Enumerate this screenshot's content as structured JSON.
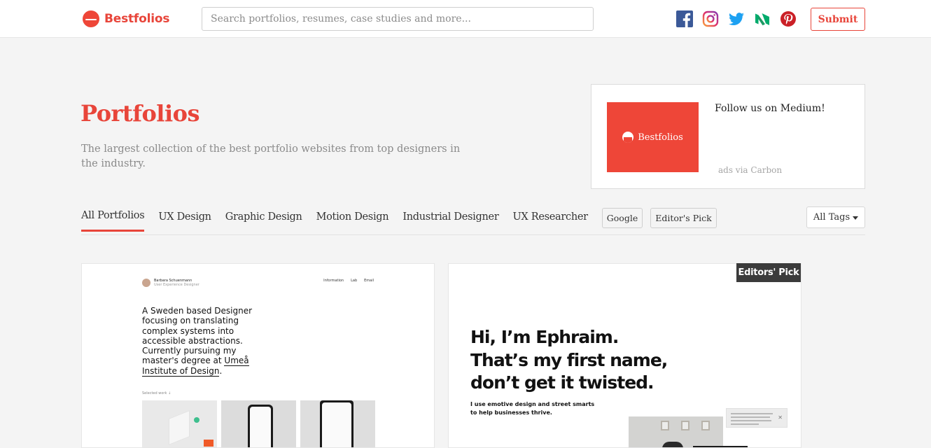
{
  "header": {
    "logo_text": "Bestfolios",
    "search_placeholder": "Search portfolios, resumes, case studies and more...",
    "social_icons": [
      "facebook-icon",
      "instagram-icon",
      "twitter-icon",
      "medium-icon",
      "pinterest-icon"
    ],
    "submit_label": "Submit"
  },
  "hero": {
    "title": "Portfolios",
    "subtitle": "The largest collection of the best portfolio websites from top designers in the industry."
  },
  "ad": {
    "image_text": "Bestfolios",
    "text": "Follow us on Medium!",
    "via": "ads via Carbon"
  },
  "filters": {
    "tabs": [
      "All Portfolios",
      "UX Design",
      "Graphic Design",
      "Motion Design",
      "Industrial Designer",
      "UX Researcher"
    ],
    "active_tab": "All Portfolios",
    "tag_buttons": [
      "Google",
      "Editor's Pick"
    ],
    "all_tags_label": "All Tags"
  },
  "cards": [
    {
      "nav_name": "Barbara Schuenmann",
      "nav_role": "User Experience Designer",
      "nav_links": [
        "Information",
        "Lab",
        "Email"
      ],
      "text_prefix": "A Sweden based Designer focusing on translating complex systems into accessible abstractions. Currently pursuing my master's degree at ",
      "text_link": "Umeå Institute of Design",
      "text_suffix": ".",
      "selected_label": "Selected work ↓"
    },
    {
      "badge": "Editors' Pick",
      "title_lines": [
        "Hi, I’m Ephraim.",
        "That’s my first name,",
        "don’t get it twisted."
      ],
      "body_lines": [
        "I use emotive design and street smarts",
        "to help businesses thrive."
      ]
    }
  ],
  "colors": {
    "brand": "#e8453a",
    "background": "#f4f4f4",
    "badge": "#3b3b3b"
  }
}
